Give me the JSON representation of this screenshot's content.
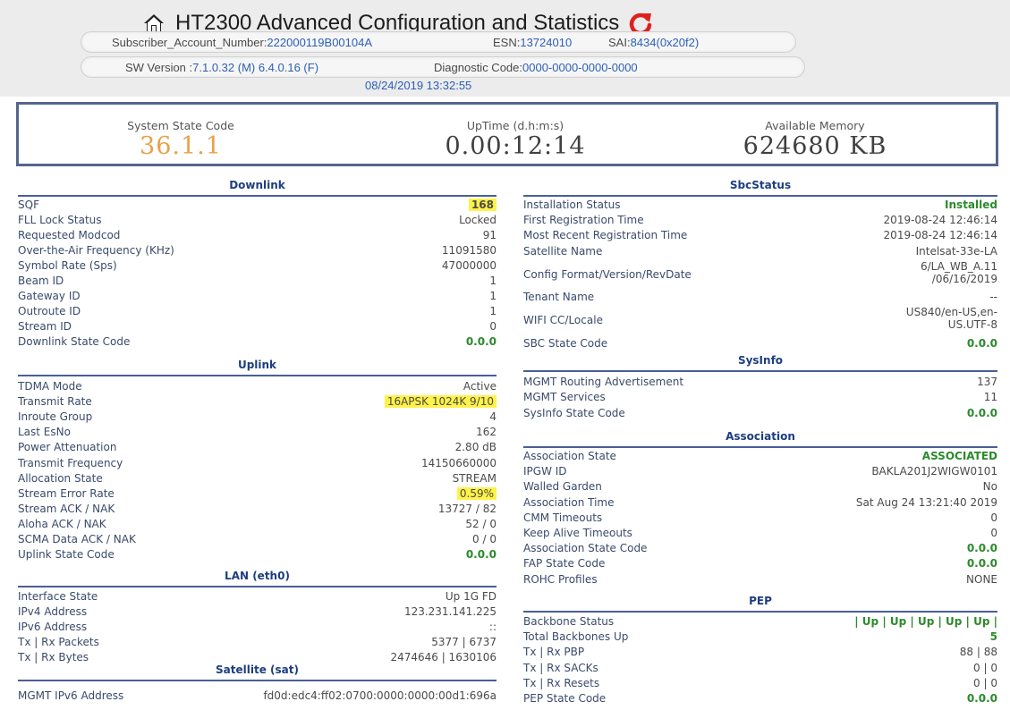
{
  "header": {
    "title": "HT2300 Advanced Configuration and Statistics",
    "subscriber_label": "Subscriber_Account_Number:",
    "subscriber_value": "222000119B00104A",
    "esn_label": "ESN:",
    "esn_value": "13724010",
    "sai_label": "SAI:",
    "sai_value": "8434(0x20f2)",
    "sw_label": "SW Version :",
    "sw_value": "7.1.0.32 (M) 6.4.0.16 (F)",
    "diag_label": "Diagnostic Code:",
    "diag_value": "0000-0000-0000-0000",
    "datetime": "08/24/2019 13:32:55",
    "icons": {
      "home": "home-icon",
      "refresh": "refresh-icon"
    },
    "refresh_color": "#e0201e"
  },
  "state": {
    "system_state_label": "System State Code",
    "system_state_value": "36.1.1",
    "uptime_label": "UpTime (d.h:m:s)",
    "uptime_value": "0.00:12:14",
    "memory_label": "Available Memory",
    "memory_value": "624680 KB"
  },
  "downlink": {
    "title": "Downlink",
    "rows": [
      {
        "k": "SQF",
        "v": "168"
      },
      {
        "k": "FLL Lock Status",
        "v": "Locked"
      },
      {
        "k": "Requested Modcod",
        "v": "91"
      },
      {
        "k": "Over-the-Air Frequency (KHz)",
        "v": "11091580"
      },
      {
        "k": "Symbol Rate (Sps)",
        "v": "47000000"
      },
      {
        "k": "Beam ID",
        "v": "1"
      },
      {
        "k": "Gateway ID",
        "v": "1"
      },
      {
        "k": "Outroute ID",
        "v": "1"
      },
      {
        "k": "Stream ID",
        "v": "0"
      },
      {
        "k": "Downlink State Code",
        "v": "0.0.0"
      }
    ]
  },
  "uplink": {
    "title": "Uplink",
    "rows": [
      {
        "k": "TDMA Mode",
        "v": "Active"
      },
      {
        "k": "Transmit Rate",
        "v": "16APSK 1024K 9/10"
      },
      {
        "k": "Inroute Group",
        "v": "4"
      },
      {
        "k": "Last EsNo",
        "v": "162"
      },
      {
        "k": "Power Attenuation",
        "v": "2.80 dB"
      },
      {
        "k": "Transmit Frequency",
        "v": "14150660000"
      },
      {
        "k": "Allocation State",
        "v": "STREAM"
      },
      {
        "k": "Stream Error Rate",
        "v": "0.59%"
      },
      {
        "k": "Stream ACK / NAK",
        "v": "13727 / 82"
      },
      {
        "k": "Aloha ACK / NAK",
        "v": "52 / 0"
      },
      {
        "k": "SCMA Data ACK / NAK",
        "v": "0 / 0"
      },
      {
        "k": "Uplink State Code",
        "v": "0.0.0"
      }
    ]
  },
  "lan": {
    "title": "LAN (eth0)",
    "rows": [
      {
        "k": "Interface State",
        "v": "Up 1G FD"
      },
      {
        "k": "IPv4 Address",
        "v": "123.231.141.225"
      },
      {
        "k": "IPv6 Address",
        "v": "::"
      },
      {
        "k": "Tx | Rx Packets",
        "v": "5377 | 6737"
      },
      {
        "k": "Tx | Rx Bytes",
        "v": "2474646 | 1630106"
      }
    ]
  },
  "satellite": {
    "title": "Satellite (sat)",
    "rows": [
      {
        "k": "MGMT IPv6 Address",
        "v": "fd0d:edc4:ff02:0700:0000:0000:00d1:696a"
      }
    ]
  },
  "sbc": {
    "title": "SbcStatus",
    "rows": [
      {
        "k": "Installation Status",
        "v": "Installed"
      },
      {
        "k": "First Registration Time",
        "v": "2019-08-24 12:46:14"
      },
      {
        "k": "Most Recent Registration Time",
        "v": "2019-08-24 12:46:14"
      },
      {
        "k": "Satellite Name",
        "v": "Intelsat-33e-LA"
      },
      {
        "k": "Config Format/Version/RevDate",
        "v": "6/LA_WB_A.11",
        "v2": "/06/16/2019"
      },
      {
        "k": "Tenant Name",
        "v": "--"
      },
      {
        "k": "WIFI CC/Locale",
        "v": "US840/en-US,en-",
        "v2": "US.UTF-8"
      },
      {
        "k": "SBC State Code",
        "v": "0.0.0"
      }
    ]
  },
  "sysinfo": {
    "title": "SysInfo",
    "rows": [
      {
        "k": "MGMT Routing Advertisement",
        "v": "137"
      },
      {
        "k": "MGMT Services",
        "v": "11"
      },
      {
        "k": "SysInfo State Code",
        "v": "0.0.0"
      }
    ]
  },
  "association": {
    "title": "Association",
    "rows": [
      {
        "k": "Association State",
        "v": "ASSOCIATED"
      },
      {
        "k": "IPGW ID",
        "v": "BAKLA201J2WIGW0101"
      },
      {
        "k": "Walled Garden",
        "v": "No"
      },
      {
        "k": "Association Time",
        "v": "Sat Aug 24 13:21:40 2019"
      },
      {
        "k": "CMM Timeouts",
        "v": "0"
      },
      {
        "k": "Keep Alive Timeouts",
        "v": "0"
      },
      {
        "k": "Association State Code",
        "v": "0.0.0"
      },
      {
        "k": "FAP State Code",
        "v": "0.0.0"
      },
      {
        "k": "ROHC Profiles",
        "v": "NONE"
      }
    ]
  },
  "pep": {
    "title": "PEP",
    "rows": [
      {
        "k": "Backbone Status",
        "v": "| Up | Up | Up | Up | Up |"
      },
      {
        "k": "Total Backbones Up",
        "v": "5"
      },
      {
        "k": "Tx | Rx PBP",
        "v": "88 | 88"
      },
      {
        "k": "Tx | Rx SACKs",
        "v": "0 | 0"
      },
      {
        "k": "Tx | Rx Resets",
        "v": "0 | 0"
      },
      {
        "k": "PEP State Code",
        "v": "0.0.0"
      }
    ]
  },
  "colors": {
    "accent_blue": "#2c5fb8",
    "section_title": "#1e3e80",
    "state_orange": "#e8a24a",
    "ok_green": "#2c8a2c",
    "highlight": "#fff24a"
  }
}
